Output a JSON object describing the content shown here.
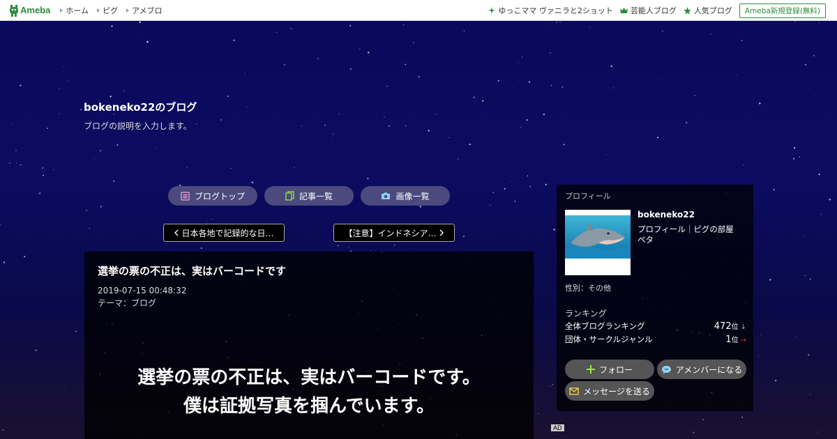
{
  "topbar": {
    "logo_text": "Ameba",
    "nav_left": [
      "ホーム",
      "ピグ",
      "アメブロ"
    ],
    "nav_right": [
      {
        "label": "ゆっこママ ヴァニラと2ショット",
        "icon": "sparkle-icon"
      },
      {
        "label": "芸能人ブログ",
        "icon": "crown-icon"
      },
      {
        "label": "人気ブログ",
        "icon": "star-icon"
      }
    ],
    "register_label": "Ameba新規登録(無料)"
  },
  "blog": {
    "title": "bokeneko22のブログ",
    "description": "ブログの説明を入力します。"
  },
  "nav_pills": [
    "ブログトップ",
    "記事一覧",
    "画像一覧"
  ],
  "prev_article": "日本各地で記録的な日…",
  "next_article": "【注意】インドネシア…",
  "article": {
    "title": "選挙の票の不正は、実はバーコードです",
    "date": "2019-07-15 00:48:32",
    "theme_prefix": "テーマ：",
    "theme": "ブログ",
    "big_line1": "選挙の票の不正は、実はバーコードです。",
    "big_line2": "僕は証拠写真を掴んでいます。"
  },
  "ad_label": "AD",
  "sidebar": {
    "label": "プロフィール",
    "name": "bokeneko22",
    "link_profile": "プロフィール",
    "link_separator": "｜",
    "link_room": "ピグの部屋",
    "link_peta": "ペタ",
    "gender": "性別：その他",
    "ranking_head": "ランキング",
    "rank_rows": [
      {
        "label": "全体ブログランキング",
        "value": "472",
        "unit": "位",
        "trend": "↓"
      },
      {
        "label": "団体・サークルジャンル",
        "value": "1",
        "unit": "位",
        "trend": "→"
      }
    ],
    "follow_label": "フォロー",
    "amember_label": "アメンバーになる",
    "message_label": "メッセージを送る"
  },
  "colors": {
    "brand_green": "#2d8c3c",
    "pill_bg": "#4a4a7e",
    "trend_red": "#ee3333"
  }
}
